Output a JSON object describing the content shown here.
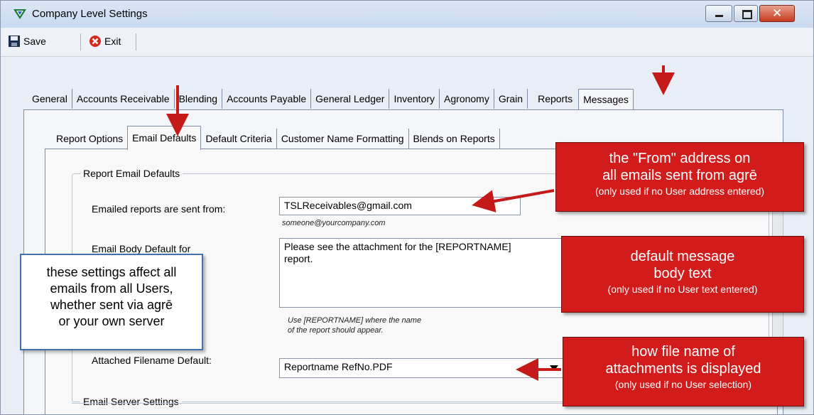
{
  "window": {
    "title": "Company Level Settings",
    "buttons": [
      "minimize",
      "maximize",
      "close"
    ]
  },
  "toolbar": {
    "save_label": "Save",
    "exit_label": "Exit"
  },
  "main_tabs": {
    "general": "General",
    "accounts_receivable": "Accounts Receivable",
    "blending": "Blending",
    "accounts_payable": "Accounts Payable",
    "general_ledger": "General Ledger",
    "inventory": "Inventory",
    "agronomy": "Agronomy",
    "grain": "Grain",
    "reports": "Reports",
    "messages": "Messages",
    "active": "Reports"
  },
  "sub_tabs": {
    "report_options": "Report Options",
    "email_defaults": "Email Defaults",
    "default_criteria": "Default Criteria",
    "customer_name_formatting": "Customer Name Formatting",
    "blends_on_reports": "Blends on Reports",
    "active": "Email Defaults"
  },
  "report_email_defaults": {
    "legend": "Report Email Defaults",
    "sent_from_label": "Emailed reports are sent from:",
    "sent_from_value": "TSLReceivables@gmail.com",
    "sent_from_hint": "someone@yourcompany.com",
    "body_label": "Email Body Default for",
    "body_value_line1": "Please see the attachment for the [REPORTNAME]",
    "body_value_line2": "report.",
    "body_hint_line1": "Use [REPORTNAME] where the name",
    "body_hint_line2": "of the report should appear.",
    "filename_label": "Attached Filename Default:",
    "filename_value": "Reportname RefNo.PDF"
  },
  "email_server": {
    "legend": "Email Server Settings"
  },
  "callouts": {
    "from": {
      "line1": "the \"From\" address on",
      "line2": "all emails sent from agrē",
      "note": "(only used if no User address entered)"
    },
    "body": {
      "line1": "default message",
      "line2": "body text",
      "note": "(only used if no User text entered)"
    },
    "filename": {
      "line1": "how file name of",
      "line2": "attachments is displayed",
      "note": "(only used if no User selection)"
    },
    "info": {
      "line1": "these settings affect all",
      "line2": "emails from all Users,",
      "line3": "whether sent via agrē",
      "line4": "or your own server"
    }
  },
  "colors": {
    "callout_red": "#d21c1c",
    "callout_blue_border": "#4470b0",
    "arrow_red": "#c41a1a"
  }
}
